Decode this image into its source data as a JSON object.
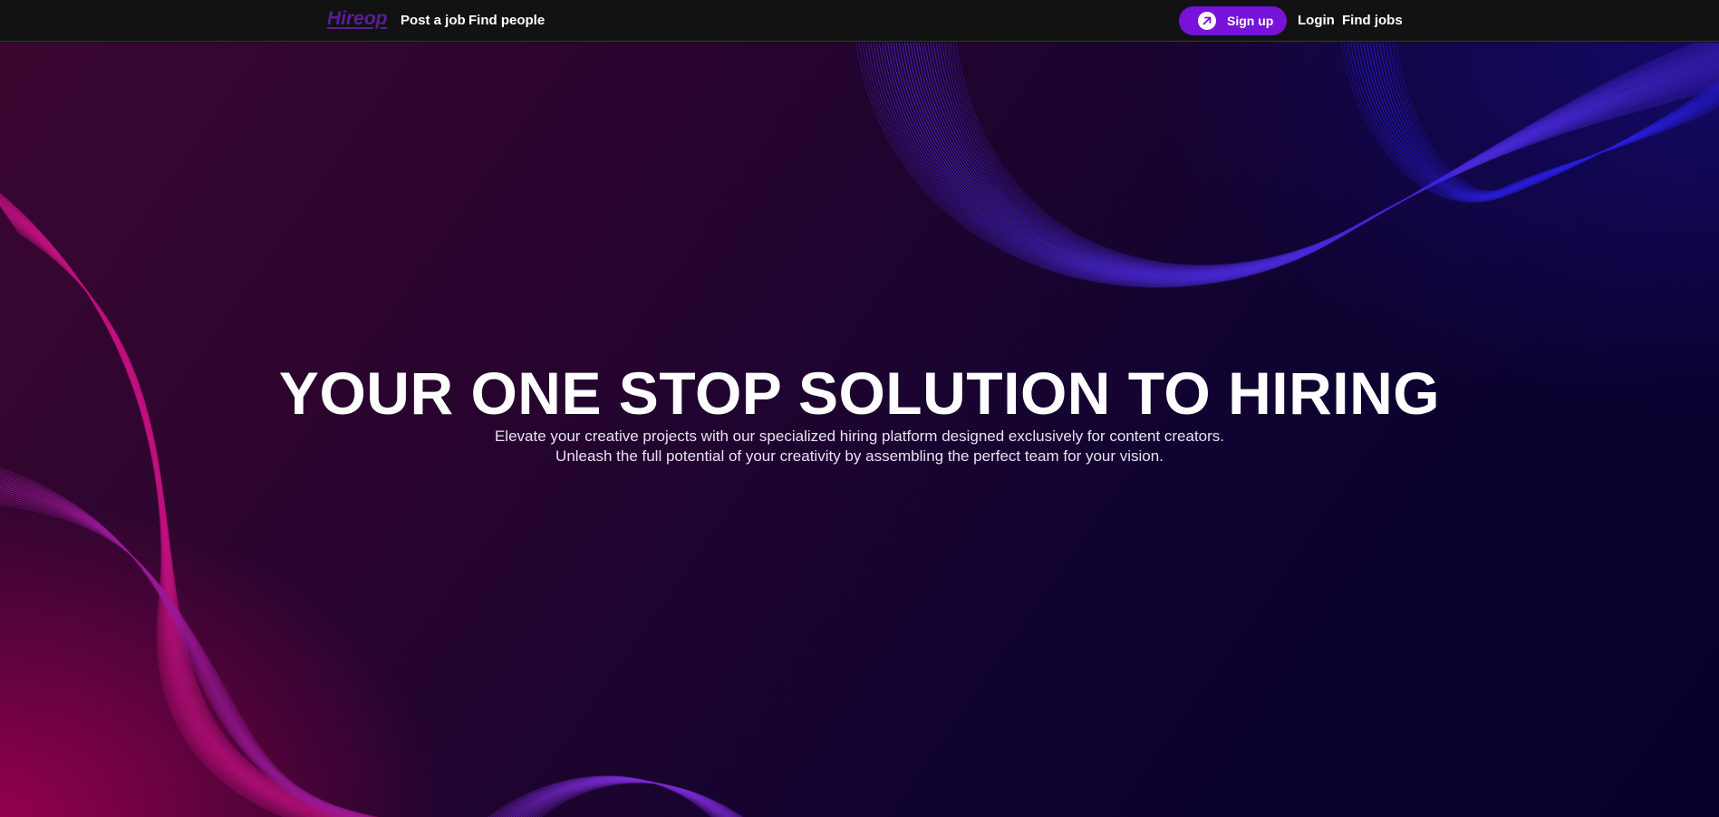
{
  "navbar": {
    "logo": "Hireop",
    "left_links": [
      "Post a job",
      "Find people"
    ],
    "signup_label": "Sign up",
    "signup_icon": "arrow-up-right-icon",
    "right_links": [
      "Login",
      "Find jobs"
    ]
  },
  "hero": {
    "title": "YOUR ONE STOP SOLUTION TO HIRING",
    "subtitle_line1": "Elevate your creative projects with our specialized hiring platform designed exclusively for content creators.",
    "subtitle_line2": "Unleash the full potential of your creativity by assembling the perfect team for your vision."
  },
  "colors": {
    "navbar_bg": "#121212",
    "logo": "#5b1c9c",
    "signup_button": "#7713d8",
    "hero_magenta": "#a50050",
    "hero_indigo": "#1a0f6e"
  }
}
